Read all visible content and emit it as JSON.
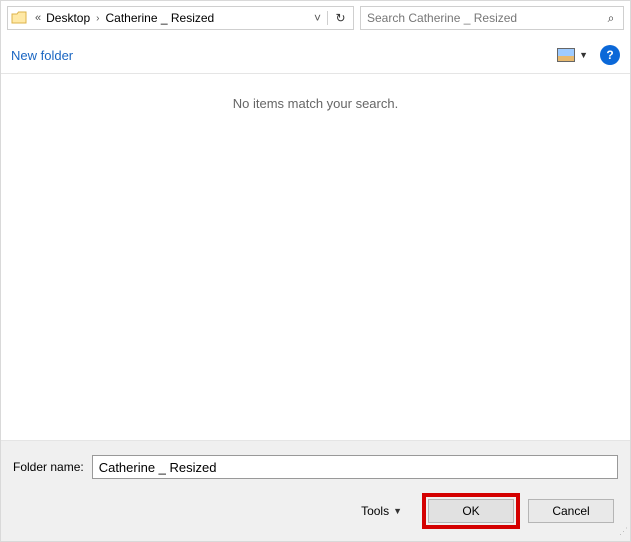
{
  "breadcrumb": {
    "parent": "Desktop",
    "current": "Catherine _ Resized"
  },
  "search": {
    "placeholder": "Search Catherine _ Resized"
  },
  "toolbar": {
    "new_folder": "New folder"
  },
  "content": {
    "empty": "No items match your search."
  },
  "bottom": {
    "label": "Folder name:",
    "value": "Catherine _ Resized",
    "tools": "Tools",
    "ok": "OK",
    "cancel": "Cancel"
  }
}
